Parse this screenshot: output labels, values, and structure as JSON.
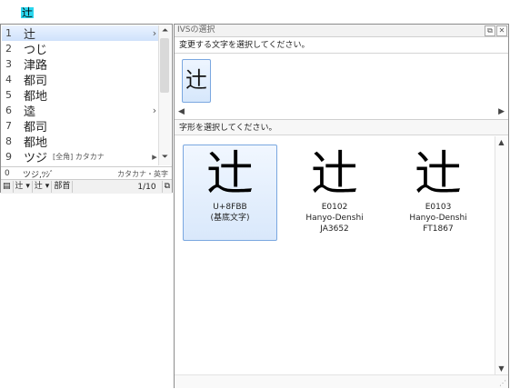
{
  "inline_text": "辻",
  "candidates": {
    "rows": [
      {
        "num": "1",
        "text": "辻",
        "note": "",
        "arrow": "›"
      },
      {
        "num": "2",
        "text": "つじ",
        "note": "",
        "arrow": ""
      },
      {
        "num": "3",
        "text": "津路",
        "note": "",
        "arrow": ""
      },
      {
        "num": "4",
        "text": "都司",
        "note": "",
        "arrow": ""
      },
      {
        "num": "5",
        "text": "都地",
        "note": "",
        "arrow": ""
      },
      {
        "num": "6",
        "text": "逵",
        "note": "",
        "arrow": "›"
      },
      {
        "num": "7",
        "text": "都司",
        "note": "",
        "arrow": ""
      },
      {
        "num": "8",
        "text": "都地",
        "note": "",
        "arrow": ""
      },
      {
        "num": "9",
        "text": "ツジ",
        "note": "[全角] カタカナ",
        "arrow": "▸"
      }
    ],
    "reading_num": "0",
    "reading_text": "ツジ,ﾂｼﾞ",
    "reading_note": "カタカナ・英字",
    "toolbar": {
      "item1": "辻",
      "item2": "辻",
      "item3": "部首",
      "page": "1/10"
    }
  },
  "ivs": {
    "title": "IVSの選択",
    "instr1": "変更する文字を選択してください。",
    "top_char": "辻",
    "instr2": "字形を選択してください。",
    "glyphs": [
      {
        "char": "辻",
        "line1": "U+8FBB",
        "line2": "(基底文字)",
        "line3": ""
      },
      {
        "char": "辻",
        "line1": "E0102",
        "line2": "Hanyo-Denshi",
        "line3": "JA3652"
      },
      {
        "char": "辻",
        "line1": "E0103",
        "line2": "Hanyo-Denshi",
        "line3": "FT1867"
      }
    ]
  }
}
